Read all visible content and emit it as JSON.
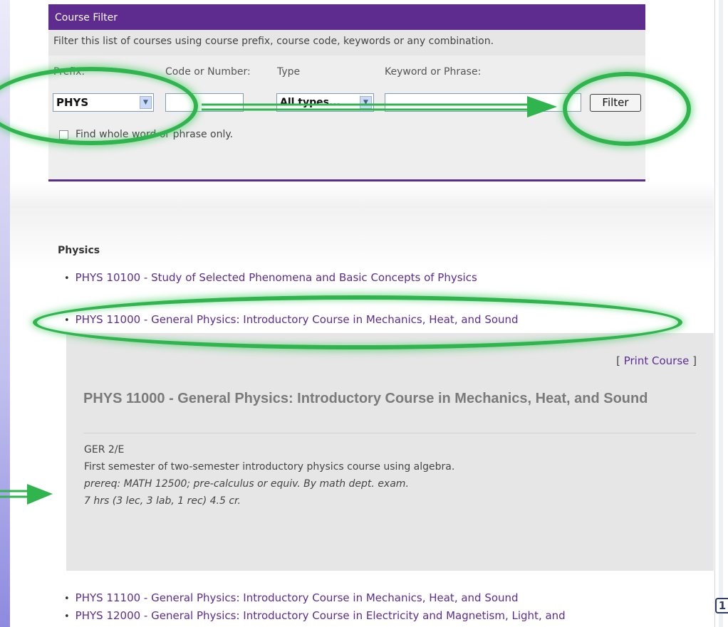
{
  "filter": {
    "title": "Course Filter",
    "description": "Filter this list of courses using course prefix, course code, keywords or any combination.",
    "labels": {
      "prefix": "Prefix:",
      "code": "Code or Number:",
      "type": "Type",
      "keyword": "Keyword or Phrase:"
    },
    "prefix_value": "PHYS",
    "code_value": "",
    "type_value": "All types...",
    "keyword_value": "",
    "button_label": "Filter",
    "whole_word_label": "Find whole word or phrase only.",
    "whole_word_checked": false
  },
  "category": "Physics",
  "courses_before": [
    "PHYS 10100 - Study of Selected Phenomena and Basic Concepts of Physics",
    "PHYS 11000 - General Physics: Introductory Course in Mechanics, Heat, and Sound"
  ],
  "detail": {
    "print_prefix": "[ ",
    "print_label": "Print Course",
    "print_suffix": " ]",
    "title": "PHYS 11000 - General Physics: Introductory Course in Mechanics, Heat, and Sound",
    "ger": "GER 2/E",
    "description": "First semester of two-semester introductory physics course using algebra.",
    "prereq": "prereq: MATH 12500; pre-calculus or equiv. By math dept. exam.",
    "hours": "7 hrs (3 lec, 3 lab, 1 rec) 4.5 cr."
  },
  "courses_after": [
    "PHYS 11100 - General Physics: Introductory Course in Mechanics, Heat, and Sound",
    "PHYS 12000 - General Physics: Introductory Course in Electricity and Magnetism, Light, and"
  ],
  "colors": {
    "brand_purple": "#5e2b8e",
    "annotation_green": "#2fb44e"
  },
  "icons": {
    "select_arrow": "chevron-down-icon",
    "annotation_arrow": "arrow-right-icon",
    "scroll_top": "back-to-top-icon"
  }
}
